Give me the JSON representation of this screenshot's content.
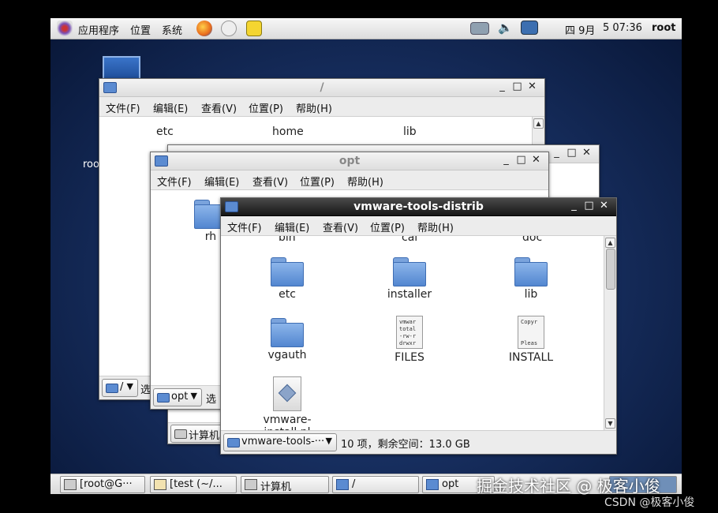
{
  "top_panel": {
    "menus": [
      "应用程序",
      "位置",
      "系统"
    ],
    "date": "四 9月",
    "time": "5 07:36",
    "user": "root"
  },
  "desktop": {
    "icon_label": "roo"
  },
  "window_root": {
    "title": "/",
    "menu": [
      "文件(F)",
      "编辑(E)",
      "查看(V)",
      "位置(P)",
      "帮助(H)"
    ],
    "items": [
      "etc",
      "home",
      "lib"
    ],
    "path": "/",
    "status": "选"
  },
  "window_opt": {
    "title": "opt",
    "menu": [
      "文件(F)",
      "编辑(E)",
      "查看(V)",
      "位置(P)",
      "帮助(H)"
    ],
    "items": [
      "rh"
    ],
    "path": "opt",
    "status": "选"
  },
  "window_computer": {
    "title": "计算机"
  },
  "window_vmware": {
    "title": "vmware-tools-distrib",
    "menu": [
      "文件(F)",
      "编辑(E)",
      "查看(V)",
      "位置(P)",
      "帮助(H)"
    ],
    "partial_items": [
      "bin",
      "cal",
      "doc"
    ],
    "items": [
      {
        "label": "etc",
        "kind": "folder"
      },
      {
        "label": "installer",
        "kind": "folder"
      },
      {
        "label": "lib",
        "kind": "folder"
      },
      {
        "label": "vgauth",
        "kind": "folder"
      },
      {
        "label": "FILES",
        "kind": "text",
        "preview": "vmwar\ntotal\n-rw-r\ndrwxr"
      },
      {
        "label": "INSTALL",
        "kind": "text",
        "preview": "Copyr\n\n\nPleas"
      },
      {
        "label": "vmware-install.pl",
        "kind": "script"
      }
    ],
    "path": "vmware-tools-···",
    "status": "10 项，剩余空间：13.0 GB"
  },
  "taskbar": [
    "[root@G···",
    "[test (~/...",
    "计算机",
    "/",
    "opt"
  ],
  "watermark": {
    "main": "掘金技术社区 @ 极客小俊",
    "csdn": "CSDN @极客小俊"
  },
  "colors": {
    "desktop": "#183062",
    "folder": "#5b8bd1",
    "active_title": "#161616"
  }
}
